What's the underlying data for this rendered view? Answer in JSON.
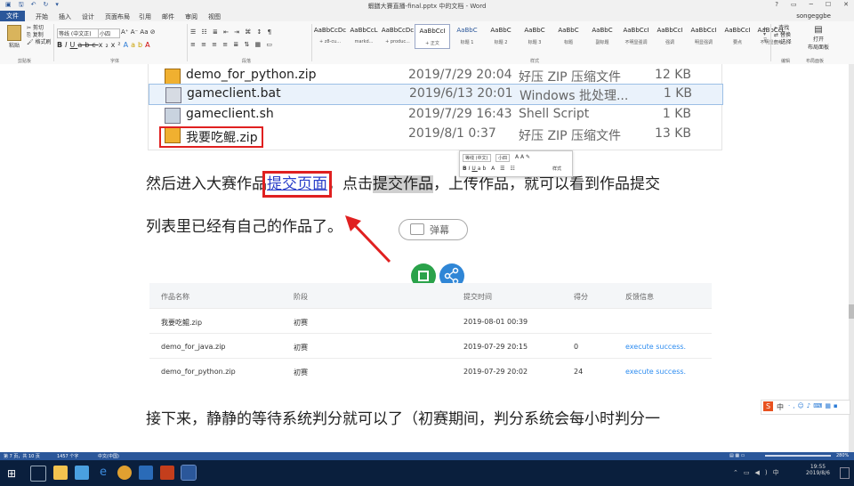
{
  "window": {
    "title": "蝦膳大賽直播-final.pptx 中的文档 - Word",
    "help": "?",
    "user": "songeggbe"
  },
  "tabs": [
    "文件",
    "开始",
    "插入",
    "设计",
    "页面布局",
    "引用",
    "邮件",
    "审阅",
    "视图"
  ],
  "ribbon": {
    "clipboard": {
      "paste": "粘贴",
      "cut": "剪切",
      "copy": "复制",
      "format_painter": "格式刷",
      "label": "剪贴板"
    },
    "font": {
      "name": "等线 (中文正)",
      "size": "小四",
      "label": "字体"
    },
    "paragraph": {
      "label": "段落"
    },
    "styles": {
      "label": "样式",
      "items": [
        {
          "preview": "AaBbCcDc",
          "name": "+ z8-cu..."
        },
        {
          "preview": "AaBbCcL",
          "name": "markd..."
        },
        {
          "preview": "AaBbCcDc",
          "name": "+ produc..."
        },
        {
          "preview": "AaBbCcI",
          "name": "+ 正文"
        },
        {
          "preview": "AaBbC",
          "name": "标题 1"
        },
        {
          "preview": "AaBbC",
          "name": "标题 2"
        },
        {
          "preview": "AaBbC",
          "name": "标题 3"
        },
        {
          "preview": "AaBbC",
          "name": "标题"
        },
        {
          "preview": "AaBbC",
          "name": "副标题"
        },
        {
          "preview": "AaBbCcI",
          "name": "不明显强调"
        },
        {
          "preview": "AaBbCcI",
          "name": "强调"
        },
        {
          "preview": "AaBbCcI",
          "name": "明显强调"
        },
        {
          "preview": "AaBbCcI",
          "name": "要点"
        },
        {
          "preview": "AaBbCcL",
          "name": "不明显参考"
        }
      ]
    },
    "editing": {
      "find": "查找",
      "replace": "替换",
      "select": "选择",
      "label": "编辑"
    },
    "layout_btn": {
      "label": "打开",
      "sub": "布局面板"
    },
    "layout_label": "布局面板"
  },
  "explorer": {
    "rows": [
      {
        "name": "demo_for_python.zip",
        "date": "2019/7/29 20:04",
        "type": "好压 ZIP 压缩文件",
        "size": "12 KB"
      },
      {
        "name": "gameclient.bat",
        "date": "2019/6/13 20:01",
        "type": "Windows 批处理...",
        "size": "1 KB"
      },
      {
        "name": "gameclient.sh",
        "date": "2019/7/29 16:43",
        "type": "Shell Script",
        "size": "1 KB"
      },
      {
        "name": "我要吃鲲.zip",
        "date": "2019/8/1 0:37",
        "type": "好压 ZIP 压缩文件",
        "size": "13 KB"
      }
    ]
  },
  "doc": {
    "p1_a": "然后进入大赛作品",
    "p1_link": "提交页面",
    "p1_b": "，点击",
    "p1_hl": "提交作品",
    "p1_c": "，上传作品，就可以看到作品提交",
    "p2": "列表里已经有自己的作品了。",
    "p3": "接下来，静静的等待系统判分就可以了（初赛期间，判分系统会每小时判分一"
  },
  "minitb": {
    "font": "等线 (中文)",
    "size": "小四",
    "styles": "样式"
  },
  "table": {
    "headers": [
      "作品名称",
      "阶段",
      "提交时间",
      "得分",
      "反馈信息"
    ],
    "rows": [
      [
        "我要吃鲲.zip",
        "初赛",
        "2019-08-01 00:39",
        "",
        ""
      ],
      [
        "demo_for_java.zip",
        "初赛",
        "2019-07-29 20:15",
        "0",
        "execute success."
      ],
      [
        "demo_for_python.zip",
        "初赛",
        "2019-07-29 20:02",
        "24",
        "execute success."
      ]
    ]
  },
  "overlay": {
    "danmu": "弹幕"
  },
  "status": {
    "page": "第 7 页，共 10 页",
    "words": "1457 个字",
    "lang": "中文(中国)",
    "zoom": "280%"
  },
  "taskbar": {
    "time": "19:55",
    "date": "2019/8/6"
  },
  "ime": {
    "label": "中"
  }
}
